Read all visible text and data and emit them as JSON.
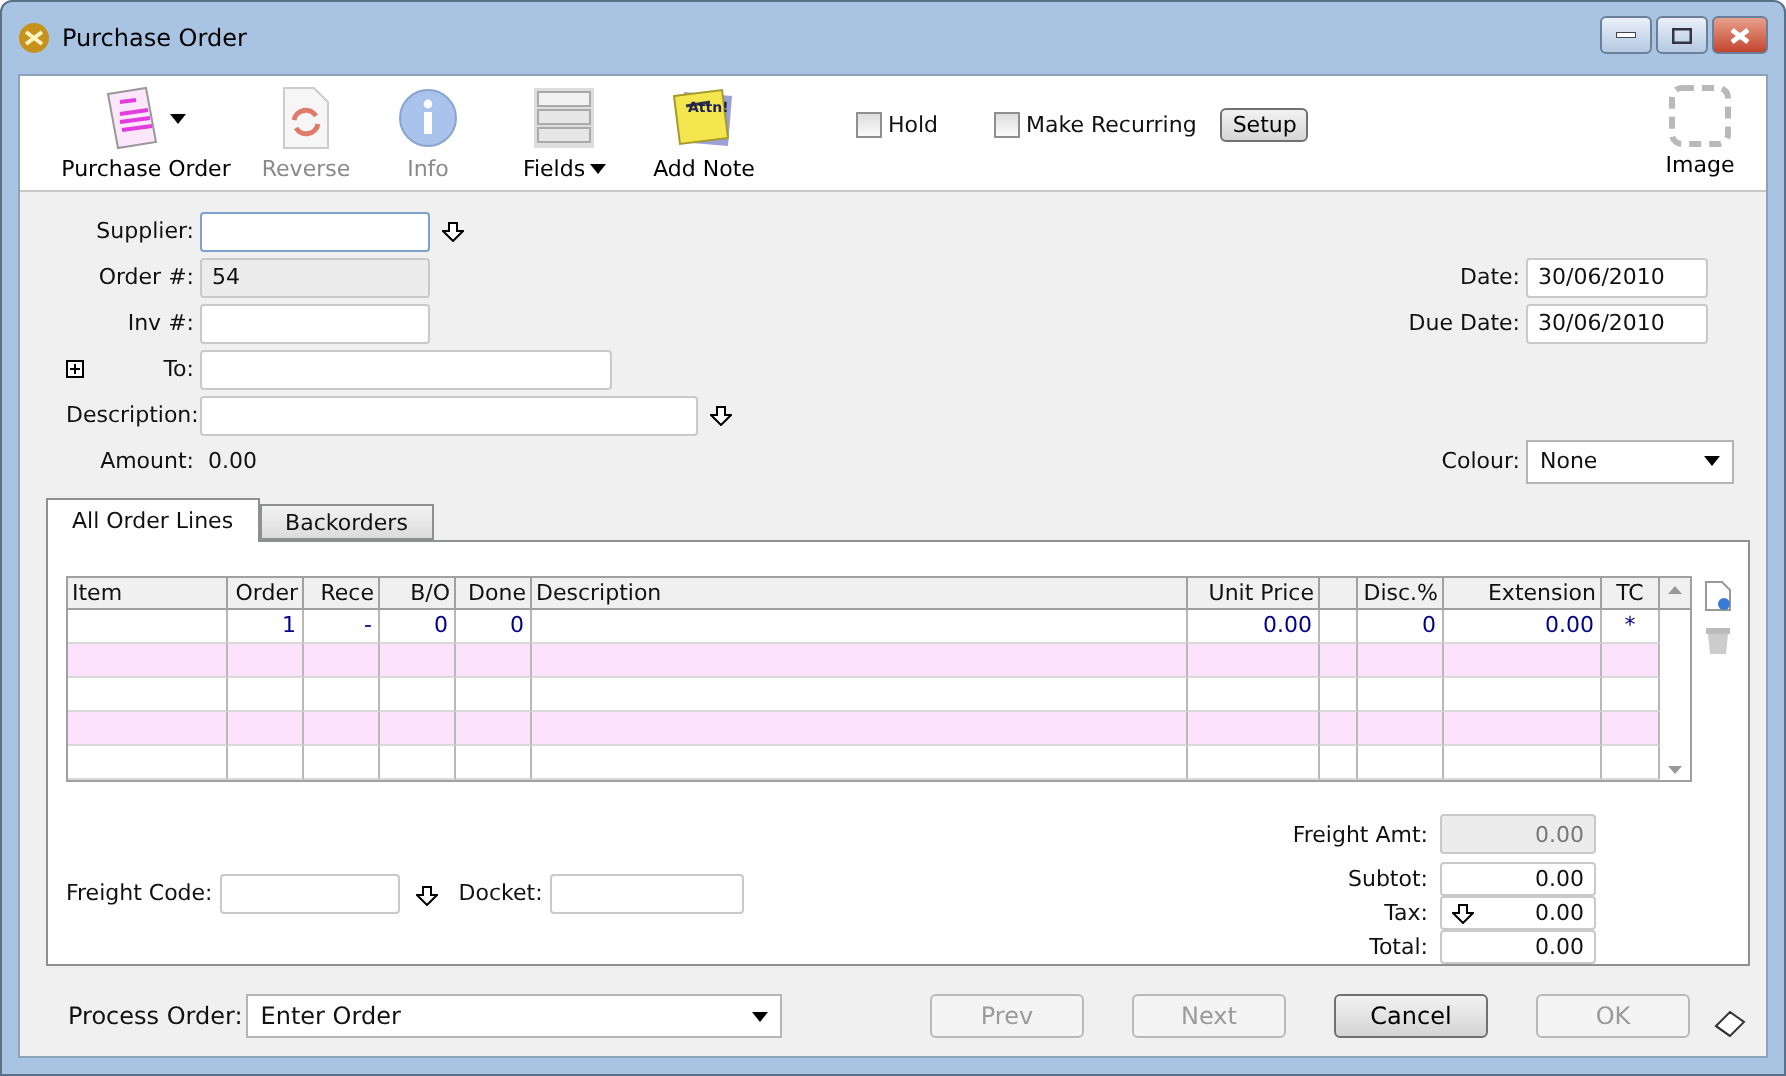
{
  "window": {
    "title": "Purchase Order"
  },
  "toolbar": {
    "items": [
      {
        "label": "Purchase Order",
        "kind": "form",
        "disabled": false,
        "dropdown": true
      },
      {
        "label": "Reverse",
        "kind": "reverse",
        "disabled": true,
        "dropdown": false
      },
      {
        "label": "Info",
        "kind": "info",
        "disabled": true,
        "dropdown": false
      },
      {
        "label": "Fields",
        "kind": "fields",
        "disabled": false,
        "dropdown": true
      },
      {
        "label": "Add Note",
        "kind": "note",
        "disabled": false,
        "dropdown": false
      }
    ],
    "note_text": "Attn!",
    "checks": [
      {
        "label": "Hold",
        "checked": false
      },
      {
        "label": "Make Recurring",
        "checked": false
      }
    ],
    "setup_button": "Setup",
    "image_label": "Image"
  },
  "form": {
    "left": [
      {
        "label": "Supplier:",
        "readonly": false,
        "focused": true,
        "lookup": true,
        "expander": false
      },
      {
        "label": "Order #:",
        "value": "54",
        "readonly": true,
        "focused": false,
        "lookup": false,
        "expander": false
      },
      {
        "label": "Inv #:",
        "readonly": false,
        "focused": false,
        "lookup": false,
        "expander": false
      },
      {
        "label": "To:",
        "readonly": false,
        "focused": false,
        "lookup": false,
        "expander": true
      },
      {
        "label": "Description:",
        "readonly": false,
        "focused": false,
        "lookup": true,
        "expander": false
      }
    ],
    "amount": {
      "label": "Amount:",
      "value": "0.00"
    },
    "date": {
      "label": "Date:",
      "value": "30/06/2010"
    },
    "due_date": {
      "label": "Due Date:",
      "value": "30/06/2010"
    },
    "colour": {
      "label": "Colour:",
      "value": "None"
    }
  },
  "tabs": [
    {
      "label": "All Order Lines",
      "selected": true
    },
    {
      "label": "Backorders",
      "selected": false
    }
  ],
  "table": {
    "columns": [
      "Item",
      "Order",
      "Rece",
      "B/O",
      "Done",
      "Description",
      "Unit Price",
      null,
      "Disc.%",
      "Extension",
      "TC"
    ],
    "rows": [
      {
        "highlighted": false,
        "cells": [
          null,
          "1",
          "-",
          "0",
          "0",
          null,
          "0.00",
          null,
          "0",
          "0.00",
          "*"
        ]
      },
      {
        "highlighted": true
      },
      {
        "highlighted": false
      },
      {
        "highlighted": true
      },
      {
        "highlighted": false
      }
    ]
  },
  "freight": {
    "code_label": "Freight Code:",
    "docket_label": "Docket:"
  },
  "totals": [
    {
      "label": "Freight Amt:",
      "value": "0.00",
      "readonly": true,
      "lookup": false
    },
    {
      "label": "Subtot:",
      "value": "0.00",
      "readonly": false,
      "lookup": false
    },
    {
      "label": "Tax:",
      "value": "0.00",
      "readonly": false,
      "lookup": true
    },
    {
      "label": "Total:",
      "value": "0.00",
      "readonly": false,
      "lookup": false
    }
  ],
  "process": {
    "label": "Process Order:",
    "value": "Enter Order"
  },
  "buttons": [
    {
      "label": "Prev",
      "disabled": true
    },
    {
      "label": "Next",
      "disabled": true
    },
    {
      "label": "Cancel",
      "disabled": false
    },
    {
      "label": "OK",
      "disabled": true
    }
  ]
}
